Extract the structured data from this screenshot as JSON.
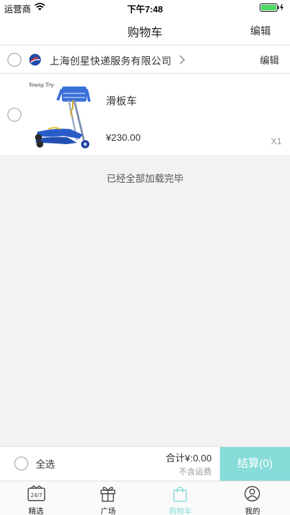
{
  "status_bar": {
    "carrier": "运营商",
    "time": "下午7:48"
  },
  "nav": {
    "title": "购物车",
    "edit_label": "编辑"
  },
  "shop": {
    "name": "上海创星快递服务有限公司",
    "edit_label": "编辑"
  },
  "product": {
    "name": "滑板车",
    "price": "¥230.00",
    "quantity": "X1",
    "image_caption": "Young Try"
  },
  "list_end_text": "已经全部加载完毕",
  "checkout": {
    "select_all_label": "全选",
    "total_text": "合计¥:0.00",
    "shipping_note": "不含运费",
    "checkout_label": "结算(0)"
  },
  "tabs": [
    {
      "label": "精选",
      "icon": "calendar-24-7-icon"
    },
    {
      "label": "广场",
      "icon": "gift-icon"
    },
    {
      "label": "购物车",
      "icon": "shopping-bag-icon",
      "active": true
    },
    {
      "label": "我的",
      "icon": "user-profile-icon"
    }
  ],
  "colors": {
    "accent": "#86dcd9",
    "background": "#f2f2f2"
  }
}
